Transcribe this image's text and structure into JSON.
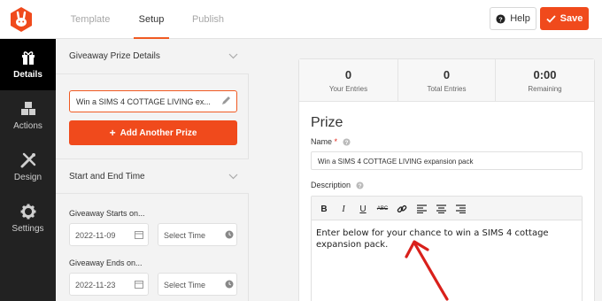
{
  "header": {
    "tabs": [
      {
        "label": "Template",
        "active": false
      },
      {
        "label": "Setup",
        "active": true
      },
      {
        "label": "Publish",
        "active": false
      }
    ],
    "help_label": "Help",
    "save_label": "Save",
    "accent_color": "#f04a1c"
  },
  "sidenav": {
    "items": [
      {
        "label": "Details",
        "icon": "gift-icon",
        "active": true
      },
      {
        "label": "Actions",
        "icon": "cubes-icon",
        "active": false
      },
      {
        "label": "Design",
        "icon": "paint-tools-icon",
        "active": false
      },
      {
        "label": "Settings",
        "icon": "gear-icon",
        "active": false
      }
    ]
  },
  "panel": {
    "prize_section_title": "Giveaway Prize Details",
    "prize_value": "Win a SIMS 4 COTTAGE LIVING ex...",
    "add_prize_label": "Add Another Prize",
    "dates_section_title": "Start and End Time",
    "starts_label": "Giveaway Starts on...",
    "start_date": "2022-11-09",
    "start_time_placeholder": "Select Time",
    "ends_label": "Giveaway Ends on...",
    "end_date": "2022-11-23",
    "end_time_placeholder": "Select Time"
  },
  "content": {
    "stats": [
      {
        "value": "0",
        "label": "Your Entries"
      },
      {
        "value": "0",
        "label": "Total Entries"
      },
      {
        "value": "0:00",
        "label": "Remaining"
      }
    ],
    "prize_heading": "Prize",
    "name_label": "Name",
    "required_mark": "*",
    "name_value": "Win a SIMS 4 COTTAGE LIVING expansion pack",
    "description_label": "Description",
    "toolbar": {
      "bold": "B",
      "italic": "I",
      "underline": "U",
      "strike": "ABC"
    },
    "description_line1": "Enter below for your chance to win a SIMS 4 cottage",
    "description_line2": "expansion pack."
  }
}
